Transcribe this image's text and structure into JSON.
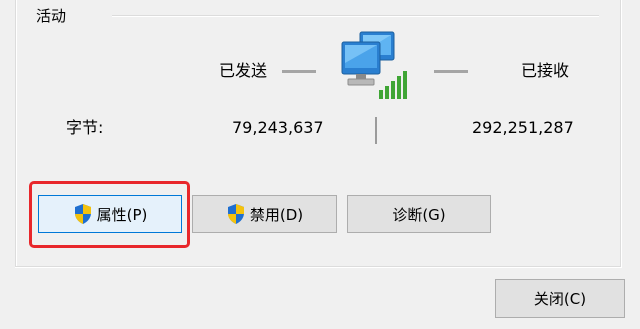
{
  "activity": {
    "title": "活动",
    "sent_label": "已发送",
    "received_label": "已接收",
    "bytes_label": "字节:",
    "bytes_sent": "79,243,637",
    "bytes_received": "292,251,287",
    "icon": "network-activity-icon"
  },
  "buttons": {
    "properties": "属性(P)",
    "disable": "禁用(D)",
    "diagnose": "诊断(G)",
    "close": "关闭(C)"
  },
  "icons": {
    "shield": "uac-shield-icon"
  },
  "colors": {
    "highlight": "#e8272b",
    "focus_border": "#0078d7"
  }
}
